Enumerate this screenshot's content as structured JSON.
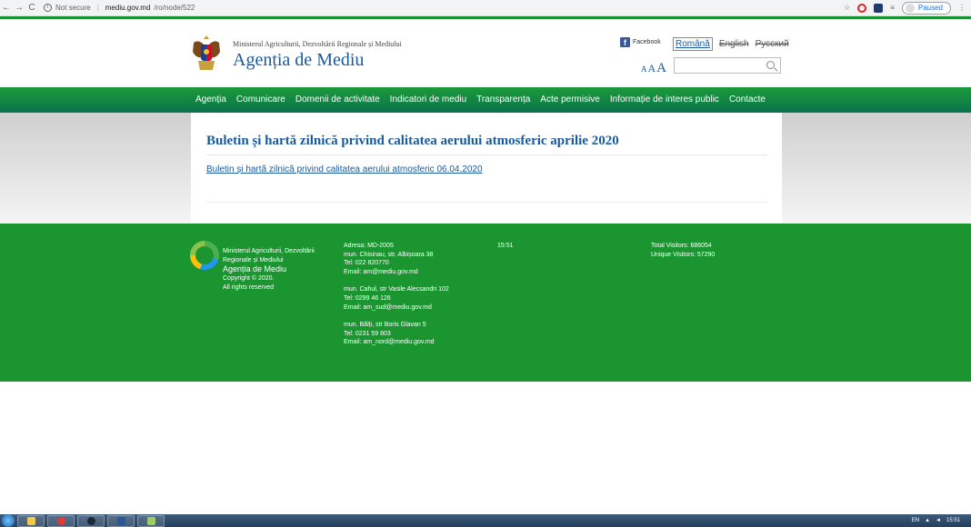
{
  "browser": {
    "back": "←",
    "forward": "→",
    "reload": "C",
    "security": "Not secure",
    "url_host": "mediu.gov.md",
    "url_path": "/ro/node/522",
    "star": "☆",
    "menu": "⋮",
    "profile_status": "Paused"
  },
  "header": {
    "ministry": "Ministerul Agriculturii, Dezvoltării Regionale și Mediului",
    "agency": "Agenția de Mediu",
    "facebook": "Facebook",
    "languages": [
      "Română",
      "English",
      "Русский"
    ],
    "font_sizes": [
      "A",
      "A",
      "A"
    ]
  },
  "menu": [
    "Agenția",
    "Comunicare",
    "Domenii de activitate",
    "Indicatori de mediu",
    "Transparența",
    "Acte permisive",
    "Informație de interes public",
    "Contacte"
  ],
  "content": {
    "title": "Buletin și hartă zilnică privind calitatea aerului atmosferic aprilie 2020",
    "link": "Buletin și hartă zilnică privind calitatea aerului atmosferic 06.04.2020"
  },
  "footer": {
    "org_line1": "Ministerul Agriculturii, Dezvoltării",
    "org_line2": "Regionale și Mediului",
    "agency": "Agenția de Mediu",
    "copyright": "Copyright © 2020.",
    "rights": "All rights reserved",
    "address_blocks": [
      [
        "Adresa: MD-2005",
        "mun. Chisinau, str. Albișoara 38",
        "Tel: 022 820770",
        "Email: am@mediu.gov.md"
      ],
      [
        "mun. Cahul, str Vasile Alecsandri 102",
        "Tel: 0299 46 126",
        "Email: am_sud@mediu.gov.md"
      ],
      [
        "mun. Bălți, str Boris Glavan 5",
        "Tel: 0231 59 803",
        "Email: am_nord@mediu.gov.md"
      ]
    ],
    "time": "15:51",
    "total_visitors": "Total Visitors: 686054",
    "unique_visitors": "Unique Visitors: 57290"
  },
  "taskbar": {
    "lang": "EN",
    "clock": "15:51"
  },
  "colors": {
    "green": "#1a9530",
    "link_blue": "#1a5a9c"
  }
}
